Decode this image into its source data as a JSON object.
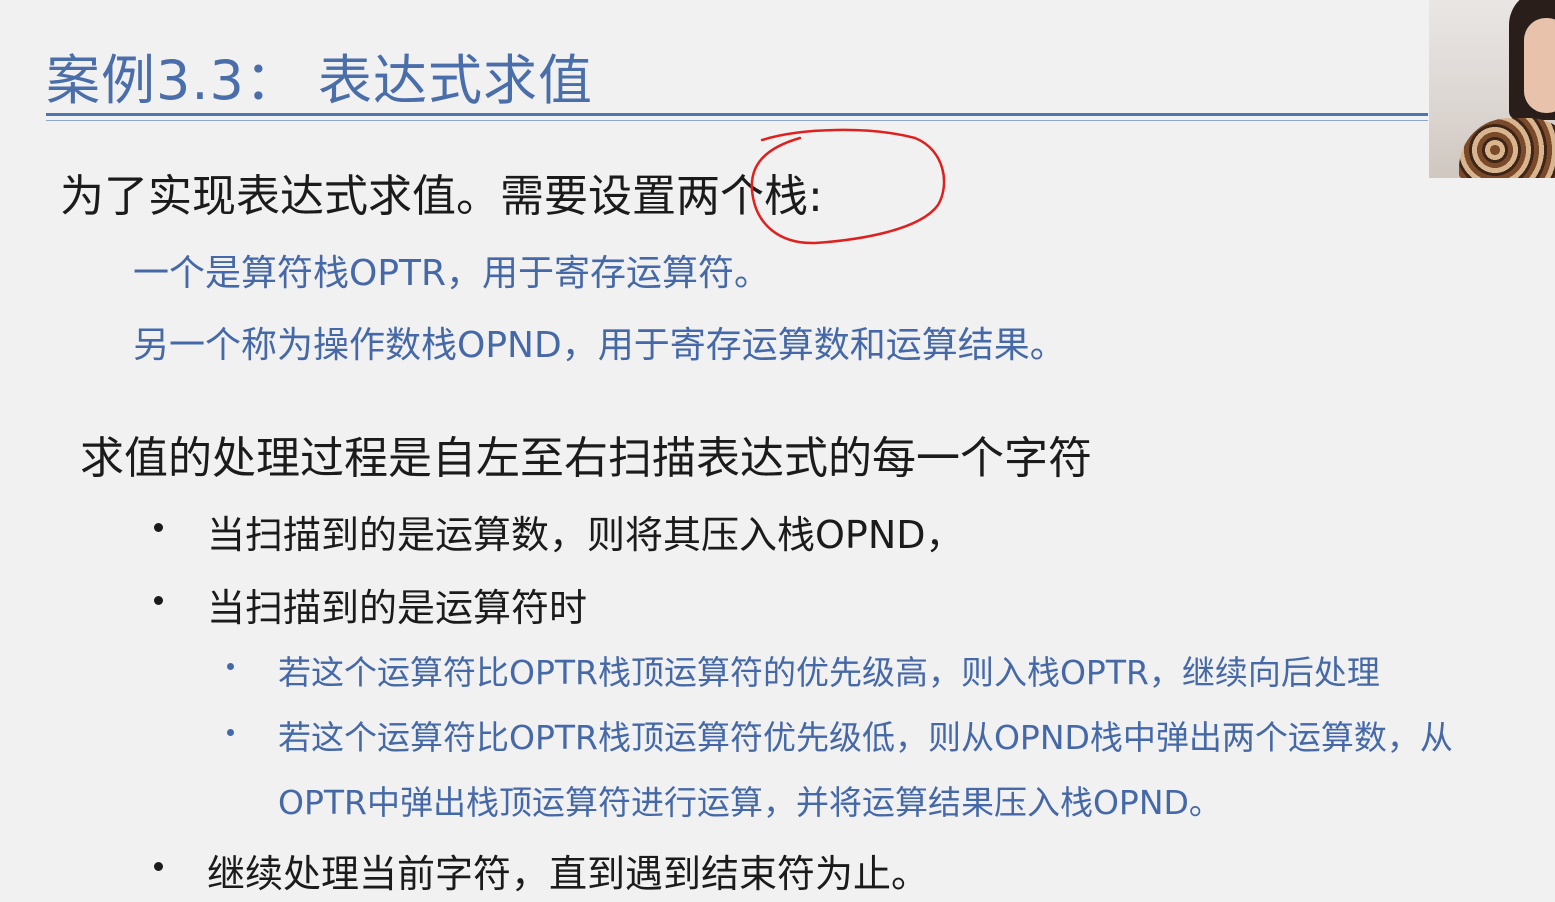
{
  "slide": {
    "title": "案例3.3： 表达式求值",
    "intro": "为了实现表达式求值。需要设置两个栈:",
    "stacks": [
      "一个是算符栈OPTR，用于寄存运算符。",
      "另一个称为操作数栈OPND，用于寄存运算数和运算结果。"
    ],
    "process_heading": "求值的处理过程是自左至右扫描表达式的每一个字符",
    "bullets": [
      "当扫描到的是运算数，则将其压入栈OPND，",
      "当扫描到的是运算符时",
      "继续处理当前字符，直到遇到结束符为止。"
    ],
    "sub_bullets": [
      "若这个运算符比OPTR栈顶运算符的优先级高，则入栈OPTR，继续向后处理",
      "若这个运算符比OPTR栈顶运算符优先级低，则从OPND栈中弹出两个运算数，从",
      "OPTR中弹出栈顶运算符进行运算，并将运算结果压入栈OPND。"
    ]
  },
  "colors": {
    "title": "#4a6ea9",
    "blue_text": "#4569a8",
    "body_text": "#1b1b1b",
    "annotation": "#e0201e",
    "background": "#f1f1f1"
  }
}
